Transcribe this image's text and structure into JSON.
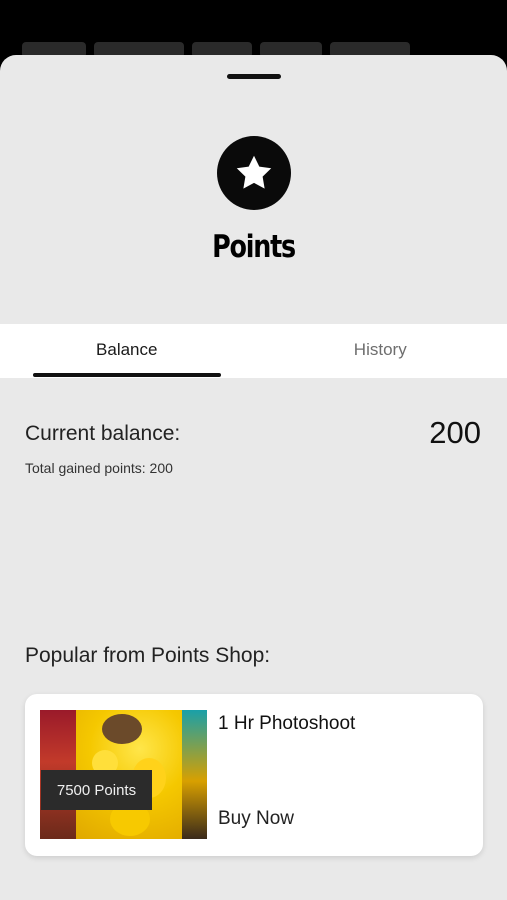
{
  "sheet": {
    "title": "Points"
  },
  "tabs": [
    {
      "label": "Balance",
      "active": true
    },
    {
      "label": "History",
      "active": false
    }
  ],
  "balance": {
    "label": "Current balance:",
    "value": "200",
    "total_gained": "Total gained points: 200"
  },
  "shop": {
    "heading": "Popular from Points Shop:",
    "items": [
      {
        "title": "1 Hr Photoshoot",
        "price_badge": "7500 Points",
        "action": "Buy Now"
      }
    ]
  },
  "icons": {
    "header_icon": "star-icon",
    "drag_handle": "drag-handle"
  },
  "colors": {
    "sheet_bg": "#e9e9e9",
    "tab_bar_bg": "#ffffff",
    "accent": "#111111",
    "badge_bg": "#2b2b2b"
  }
}
